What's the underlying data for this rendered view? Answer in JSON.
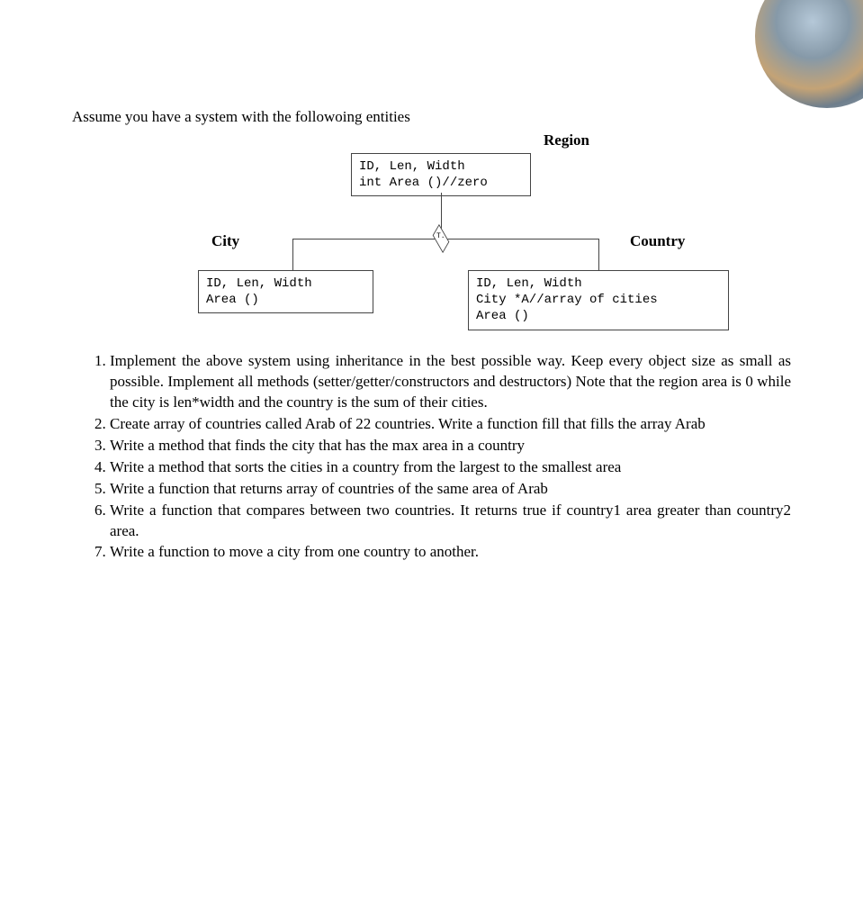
{
  "intro": "Assume you have a system with the followoing entities",
  "diagram": {
    "region_label": "Region",
    "region_box_line1": "ID, Len, Width",
    "region_box_line2": "int Area ()//zero",
    "diamond_label": "T.",
    "city_label": "City",
    "city_box_line1": "ID, Len, Width",
    "city_box_line2": "Area ()",
    "country_label": "Country",
    "country_box_line1": "ID, Len, Width",
    "country_box_line2": "City *A//array of cities",
    "country_box_line3": "Area ()"
  },
  "questions": [
    "Implement the above system using inheritance in the best possible way. Keep every object size as small as possible. Implement all methods (setter/getter/constructors and destructors) Note that the region area is 0 while the city is len*width and the country is the sum of their cities.",
    "Create array of countries called Arab of 22 countries. Write a function fill that fills the array Arab",
    " Write a method that finds the city that has the max area in a country",
    "Write a method that sorts the cities in a country from the largest to the smallest area",
    "Write a function that returns array of countries of the same area of Arab",
    "Write a function that compares between two countries. It returns true if country1 area greater than country2 area.",
    "Write a function to move a city from one country to another."
  ]
}
